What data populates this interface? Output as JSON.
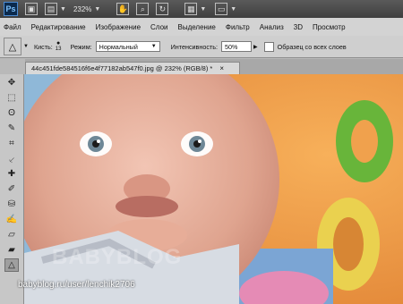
{
  "app": {
    "logo_text": "Ps",
    "zoom_level": "232%",
    "icons": [
      "file-browse-icon",
      "view-extras-icon",
      "zoom-icon",
      "hand-icon",
      "magnifier-icon",
      "rotate-icon",
      "grid-icon",
      "screen-mode-icon"
    ]
  },
  "menu": {
    "items": [
      "Файл",
      "Редактирование",
      "Изображение",
      "Слои",
      "Выделение",
      "Фильтр",
      "Анализ",
      "3D",
      "Просмотр"
    ]
  },
  "options": {
    "brush_label": "Кисть:",
    "brush_size": "13",
    "mode_label": "Режим:",
    "mode_value": "Нормальный",
    "intensity_label": "Интенсивность:",
    "intensity_value": "50%",
    "sample_all_label": "Образец со всех слоев"
  },
  "document": {
    "tab_title": "44c451fde584516f6e4f77182ab547f0.jpg @ 232% (RGB/8) *",
    "close_symbol": "×"
  },
  "toolbox": {
    "tools": [
      "move",
      "marquee",
      "lasso",
      "quick-select",
      "crop",
      "eyedropper",
      "healing",
      "brush",
      "stamp",
      "history-brush",
      "eraser",
      "gradient",
      "smudge"
    ]
  },
  "canvas": {
    "watermark": "BABYBLOG",
    "credit": "babyblog.ru/user/lenchik2706"
  },
  "colors": {
    "app_bar": "#4a4a4a",
    "menu_bar": "#d3d3d3",
    "canvas_bg": "#f1a14a"
  }
}
